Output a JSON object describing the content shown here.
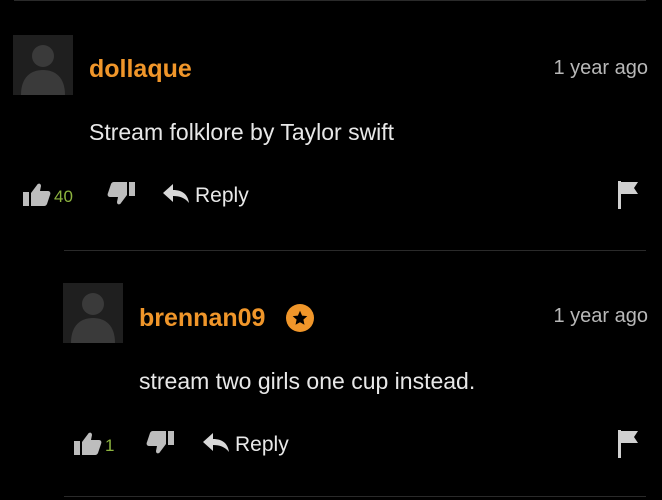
{
  "comments": [
    {
      "username": "dollaque",
      "timestamp": "1 year ago",
      "text": "Stream folklore by Taylor swift",
      "likes": "40",
      "reply_label": "Reply"
    },
    {
      "username": "brennan09",
      "timestamp": "1 year ago",
      "text": "stream two girls one cup instead.",
      "likes": "1",
      "reply_label": "Reply",
      "badge": "star-badge"
    }
  ],
  "colors": {
    "username": "#f0962a",
    "like_count": "#8db43f",
    "text": "#e8e8e8",
    "timestamp": "#b8b8b8"
  }
}
